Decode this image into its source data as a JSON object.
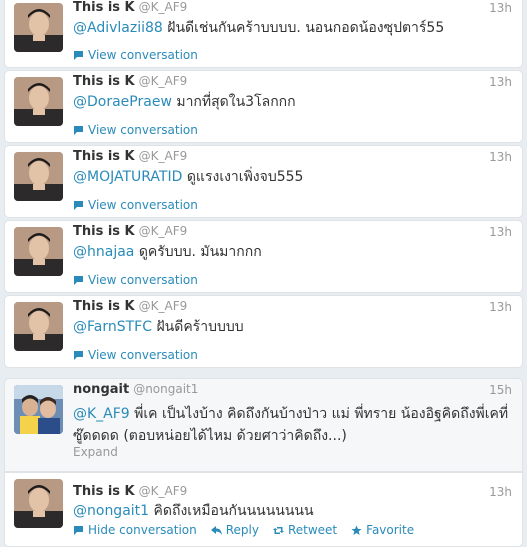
{
  "colors": {
    "link": "#2a8bba",
    "name": "#333333",
    "meta": "#999999"
  },
  "tweets": [
    {
      "fullname": "This is K",
      "username": "@K_AF9",
      "time": "13h",
      "mention": "@Adivlazii88",
      "text": "ฝันดีเช่นกันคร้าบบบบ. นอนกอดน้องซุปตาร์55",
      "action": "View conversation"
    },
    {
      "fullname": "This is K",
      "username": "@K_AF9",
      "time": "13h",
      "mention": "@DoraePraew",
      "text": "มากที่สุดใน3โลกกก",
      "action": "View conversation"
    },
    {
      "fullname": "This is K",
      "username": "@K_AF9",
      "time": "13h",
      "mention": "@MOJATURATID",
      "text": "ดูแรงเงาเพิ่งจบ555",
      "action": "View conversation"
    },
    {
      "fullname": "This is K",
      "username": "@K_AF9",
      "time": "13h",
      "mention": "@hnajaa",
      "text": "ดูครับบบ. มันมากกก",
      "action": "View conversation"
    },
    {
      "fullname": "This is K",
      "username": "@K_AF9",
      "time": "13h",
      "mention": "@FarnSTFC",
      "text": "ฝันดีคร้าบบบบ",
      "action": "View conversation"
    }
  ],
  "nongait_tweet": {
    "fullname": "nongait",
    "username": "@nongait1",
    "time": "15h",
    "mention": "@K_AF9",
    "text": "พี่เค เป็นไงบ้าง คิดถึงกันบ้างป่าว แม่ พี่ทราย น้องอิฐคิดถึงพี่เคที่ซู๊ดดดด (ตอบหน่อยได้ไหม ด้วยศาว่าคิดถึง...)",
    "expand": "Expand"
  },
  "reply_tweet": {
    "fullname": "This is K",
    "username": "@K_AF9",
    "time": "13h",
    "mention": "@nongait1",
    "text": "คิดถึงเหมือนกันนนนนนนน",
    "hide": "Hide conversation",
    "reply": "Reply",
    "retweet": "Retweet",
    "favorite": "Favorite"
  }
}
